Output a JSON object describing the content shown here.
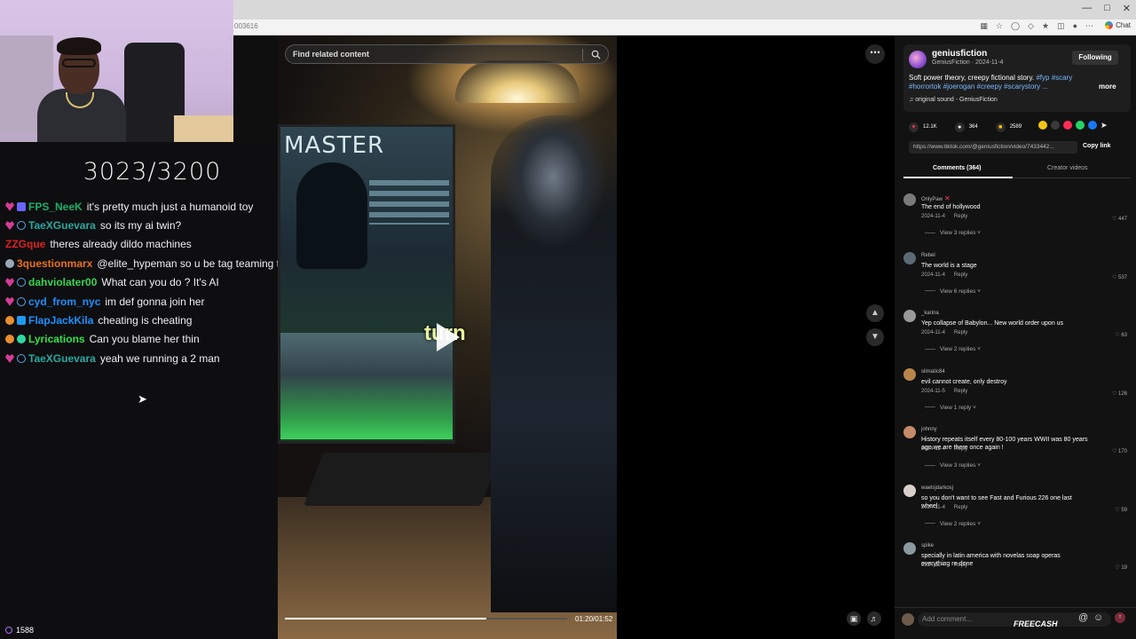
{
  "browser": {
    "url_fragment": "003616",
    "chat_label": "Chat"
  },
  "stream": {
    "goal_counter": "3023/3200",
    "viewer_count": "1588"
  },
  "chat": [
    {
      "user": "FPS_NeeK",
      "color": "#1fae68",
      "badges": [
        "heart",
        "mod"
      ],
      "text": "it's pretty much just a humanoid toy"
    },
    {
      "user": "TaeXGuevara",
      "color": "#2aa8a0",
      "badges": [
        "heart",
        "ring"
      ],
      "text": "so its my ai twin?"
    },
    {
      "user": "ZZGque",
      "color": "#e02020",
      "badges": [],
      "text": "theres already dildo machines"
    },
    {
      "user": "3questionmarx",
      "color": "#e8701c",
      "badges": [
        "glasses"
      ],
      "text": "@elite_hypeman so u be tag teaming type shit"
    },
    {
      "user": "dahviolater00",
      "color": "#39d353",
      "badges": [
        "heart",
        "ring"
      ],
      "text": "What can you do ? It's AI"
    },
    {
      "user": "cyd_from_nyc",
      "color": "#1e90ff",
      "badges": [
        "heart",
        "ring"
      ],
      "text": "im def gonna join her"
    },
    {
      "user": "FlapJackKila",
      "color": "#1e90ff",
      "badges": [
        "orange",
        "blue"
      ],
      "text": "cheating is cheating"
    },
    {
      "user": "Lyrications",
      "color": "#34e04a",
      "badges": [
        "orange",
        "green"
      ],
      "text": "Can you blame her thin"
    },
    {
      "user": "TaeXGuevara",
      "color": "#2aa8a0",
      "badges": [
        "heart",
        "ring"
      ],
      "text": "yeah we running a 2 man"
    }
  ],
  "video": {
    "search_placeholder": "Find related content",
    "screen_title": "MASTER",
    "caption": "turn",
    "time": "01:20/01:52",
    "progress": 0.715
  },
  "post": {
    "author_name": "geniusfiction",
    "author_handle": "GeniusFiction",
    "date": "2024-11-4",
    "following_label": "Following",
    "desc_text": "Soft power theory, creepy fictional story.",
    "desc_tags": "#fyp #scary #horrortok #joerogan #creepy #scarystory ...",
    "more_label": "more",
    "sound": "original sound - GeniusFiction",
    "likes": "12.1K",
    "comments_count": "364",
    "saves": "2589",
    "link": "https://www.tiktok.com/@geniusfiction/video/7433442...",
    "copy_label": "Copy link"
  },
  "tabs": {
    "comments": "Comments (364)",
    "creator": "Creator videos"
  },
  "comments": [
    {
      "user": "OnlyPaw",
      "text": "The end of hollywood",
      "date": "2024-11-4",
      "likes": "447",
      "view": "View 3 replies",
      "avatar": "#7a7a7a",
      "flag": true
    },
    {
      "user": "Rebel",
      "text": "The world is a stage",
      "date": "2024-11-4",
      "likes": "537",
      "view": "View 6 replies",
      "avatar": "#5b6a74",
      "flag": false
    },
    {
      "user": "_karina",
      "text": "Yep collapse of Babylon... New world order upon us",
      "date": "2024-11-4",
      "likes": "63",
      "view": "View 2 replies",
      "avatar": "#999999",
      "flag": false
    },
    {
      "user": "slimatic84",
      "text": "evil cannot create, only destroy",
      "date": "2024-11-5",
      "likes": "126",
      "view": "View 1 reply",
      "avatar": "#b8864a",
      "flag": false
    },
    {
      "user": "johnny",
      "text": "History repeats itself every 80-100 years WWII was 80 years ago we are there once again !",
      "date": "2024-11-4",
      "likes": "170",
      "view": "View 3 replies",
      "avatar": "#c48a6a",
      "flag": false
    },
    {
      "user": "waelsjdarkosj",
      "text": "so you don't want to see Fast and Furious 226 one last wheel",
      "date": "2024-11-4",
      "likes": "59",
      "view": "View 2 replies",
      "avatar": "#d9d0cc",
      "flag": false
    },
    {
      "user": "spike",
      "text": "specially in latin america with novelas soap operas everything re-done",
      "date": "2024-11-4",
      "likes": "19",
      "view": "",
      "avatar": "#8a9aa0",
      "flag": false
    }
  ],
  "reply_label": "Reply",
  "comment_bar": {
    "placeholder": "Add comment...",
    "brand": "FREECASH"
  },
  "colors": {
    "accent": "#fe2c55",
    "link": "#79b8ff"
  }
}
